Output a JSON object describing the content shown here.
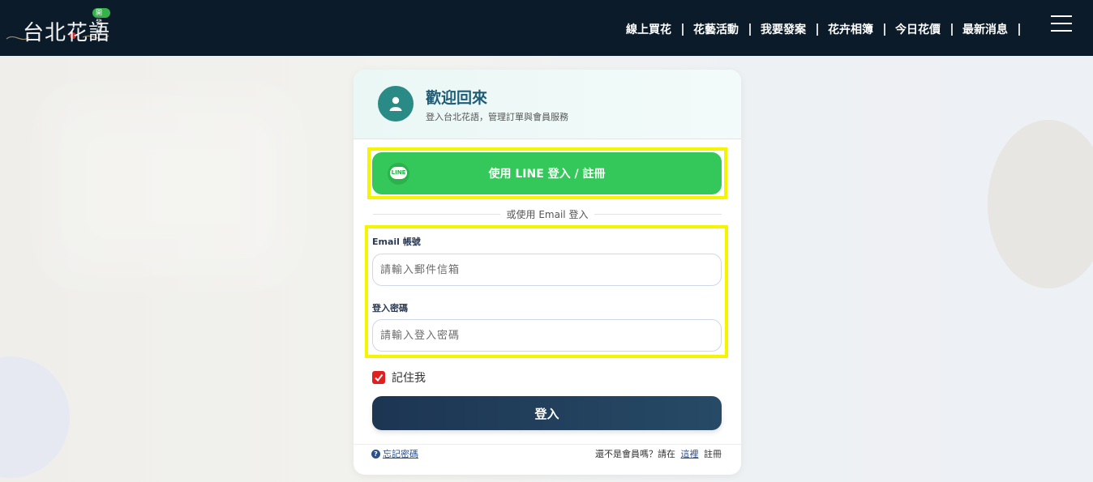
{
  "header": {
    "logo_text": "台北花語",
    "dev_badge": "開發版",
    "nav": [
      "線上買花",
      "花藝活動",
      "我要發案",
      "花卉相簿",
      "今日花價",
      "最新消息"
    ]
  },
  "card": {
    "title": "歡迎回來",
    "subtitle": "登入台北花語，管理訂單與會員服務",
    "line_icon_text": "LINE",
    "line_button": "使用 LINE 登入 / 註冊",
    "divider": "或使用 Email 登入",
    "email_label": "Email 帳號",
    "email_placeholder": "請輸入郵件信箱",
    "password_label": "登入密碼",
    "password_placeholder": "請輸入登入密碼",
    "remember_label": "記住我",
    "remember_checked": true,
    "login_button": "登入",
    "forgot": "忘記密碼",
    "register_prefix": "還不是會員嗎？請在",
    "register_link": "這裡",
    "register_suffix": "註冊"
  },
  "colors": {
    "topbar": "#0b1b2a",
    "line_green": "#34c759",
    "login_navy": "#1c3552",
    "highlight": "#f5f500",
    "accent_teal": "#2a8a85"
  }
}
